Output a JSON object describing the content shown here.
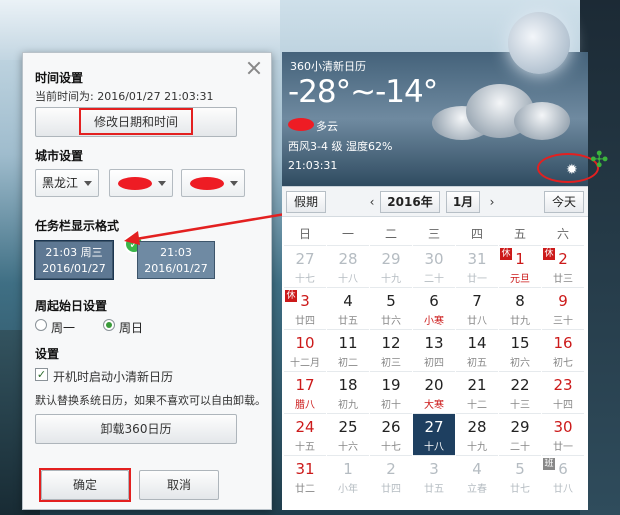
{
  "settings": {
    "time_section": "时间设置",
    "current_time": "当前时间为: 2016/01/27 21:03:31",
    "modify_button": "修改日期和时间",
    "city_section": "城市设置",
    "city_province": "黑龙江",
    "taskbar_section": "任务栏显示格式",
    "format1_line1": "21:03 周三",
    "format1_line2": "2016/01/27",
    "format2_line1": "21:03",
    "format2_line2": "2016/01/27",
    "week_start_section": "周起始日设置",
    "week_monday": "周一",
    "week_sunday": "周日",
    "settings_section": "设置",
    "autostart_label": "开机时启动小清新日历",
    "replace_note": "默认替换系统日历，如果不喜欢可以自由卸载。",
    "uninstall_button": "卸载360日历",
    "ok_button": "确定",
    "cancel_button": "取消"
  },
  "weather": {
    "app_title": "360小清新日历",
    "temp": "-28°~-14°",
    "condition": "多云",
    "wind_humidity": "西风3-4 级 湿度62%",
    "time": "21:03:31"
  },
  "calendar": {
    "holiday_button": "假期",
    "year": "2016年",
    "month": "1月",
    "today_button": "今天",
    "weekdays": [
      "日",
      "一",
      "二",
      "三",
      "四",
      "五",
      "六"
    ],
    "days": [
      {
        "n": "27",
        "l": "十七"
      },
      {
        "n": "28",
        "l": "十八"
      },
      {
        "n": "29",
        "l": "十九"
      },
      {
        "n": "30",
        "l": "二十"
      },
      {
        "n": "31",
        "l": "廿一"
      },
      {
        "n": "1",
        "l": "元旦",
        "tag": "休"
      },
      {
        "n": "2",
        "l": "廿三",
        "tag": "休"
      },
      {
        "n": "3",
        "l": "廿四",
        "tag": "休"
      },
      {
        "n": "4",
        "l": "廿五"
      },
      {
        "n": "5",
        "l": "廿六"
      },
      {
        "n": "6",
        "l": "小寒"
      },
      {
        "n": "7",
        "l": "廿八"
      },
      {
        "n": "8",
        "l": "廿九"
      },
      {
        "n": "9",
        "l": "三十"
      },
      {
        "n": "10",
        "l": "十二月"
      },
      {
        "n": "11",
        "l": "初二"
      },
      {
        "n": "12",
        "l": "初三"
      },
      {
        "n": "13",
        "l": "初四"
      },
      {
        "n": "14",
        "l": "初五"
      },
      {
        "n": "15",
        "l": "初六"
      },
      {
        "n": "16",
        "l": "初七"
      },
      {
        "n": "17",
        "l": "腊八"
      },
      {
        "n": "18",
        "l": "初九"
      },
      {
        "n": "19",
        "l": "初十"
      },
      {
        "n": "20",
        "l": "大寒"
      },
      {
        "n": "21",
        "l": "十二"
      },
      {
        "n": "22",
        "l": "十三"
      },
      {
        "n": "23",
        "l": "十四"
      },
      {
        "n": "24",
        "l": "十五"
      },
      {
        "n": "25",
        "l": "十六"
      },
      {
        "n": "26",
        "l": "十七"
      },
      {
        "n": "27",
        "l": "十八"
      },
      {
        "n": "28",
        "l": "十九"
      },
      {
        "n": "29",
        "l": "二十"
      },
      {
        "n": "30",
        "l": "廿一"
      },
      {
        "n": "31",
        "l": "廿二"
      },
      {
        "n": "1",
        "l": "小年"
      },
      {
        "n": "2",
        "l": "廿四"
      },
      {
        "n": "3",
        "l": "廿五"
      },
      {
        "n": "4",
        "l": "立春"
      },
      {
        "n": "5",
        "l": "廿七"
      },
      {
        "n": "6",
        "l": "廿八",
        "tag": "班"
      }
    ]
  }
}
